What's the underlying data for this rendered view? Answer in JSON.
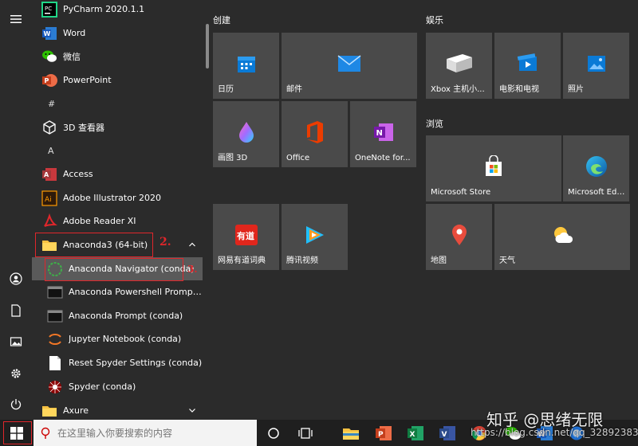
{
  "app_list": {
    "items": [
      {
        "label": "PyCharm 2020.1.1",
        "icon": "pycharm-icon"
      },
      {
        "label": "Word",
        "icon": "word-icon"
      },
      {
        "label": "微信",
        "icon": "wechat-icon"
      },
      {
        "label": "PowerPoint",
        "icon": "powerpoint-icon"
      },
      {
        "label": "#"
      },
      {
        "label": "3D 查看器",
        "icon": "3d-viewer-icon"
      },
      {
        "label": "A"
      },
      {
        "label": "Access",
        "icon": "access-icon"
      },
      {
        "label": "Adobe Illustrator 2020",
        "icon": "illustrator-icon"
      },
      {
        "label": "Adobe Reader XI",
        "icon": "acrobat-icon"
      },
      {
        "label": "Anaconda3 (64-bit)",
        "icon": "folder-icon"
      },
      {
        "label": "Anaconda Navigator (conda)",
        "icon": "anaconda-icon"
      },
      {
        "label": "Anaconda Powershell Prompt (co...",
        "icon": "terminal-icon"
      },
      {
        "label": "Anaconda Prompt (conda)",
        "icon": "terminal-icon"
      },
      {
        "label": "Jupyter Notebook (conda)",
        "icon": "jupyter-icon"
      },
      {
        "label": "Reset Spyder Settings (conda)",
        "icon": "document-icon"
      },
      {
        "label": "Spyder (conda)",
        "icon": "spyder-icon"
      },
      {
        "label": "Axure",
        "icon": "folder-icon"
      }
    ]
  },
  "annotations": {
    "step2": "2.",
    "step3": "3."
  },
  "groups": {
    "create": "创建",
    "entertainment": "娱乐",
    "browse": "浏览"
  },
  "tiles": {
    "calendar": "日历",
    "mail": "邮件",
    "paint3d": "画图 3D",
    "office": "Office",
    "onenote": "OneNote for...",
    "youdao": "网易有道词典",
    "tencent_video": "腾讯视频",
    "xbox": "Xbox 主机小...",
    "movies": "电影和电视",
    "photos": "照片",
    "store": "Microsoft Store",
    "edge": "Microsoft Edge",
    "maps": "地图",
    "weather": "天气"
  },
  "taskbar": {
    "search_placeholder": "在这里输入你要搜索的内容"
  },
  "watermark": {
    "zhihu": "知乎 @思绪无限",
    "url": "https://blog.csdn.net/qq_32892383"
  },
  "colors": {
    "accent_red": "#e0262b",
    "tile_bg": "#4a4a4a",
    "menu_bg": "#2b2b2b"
  }
}
